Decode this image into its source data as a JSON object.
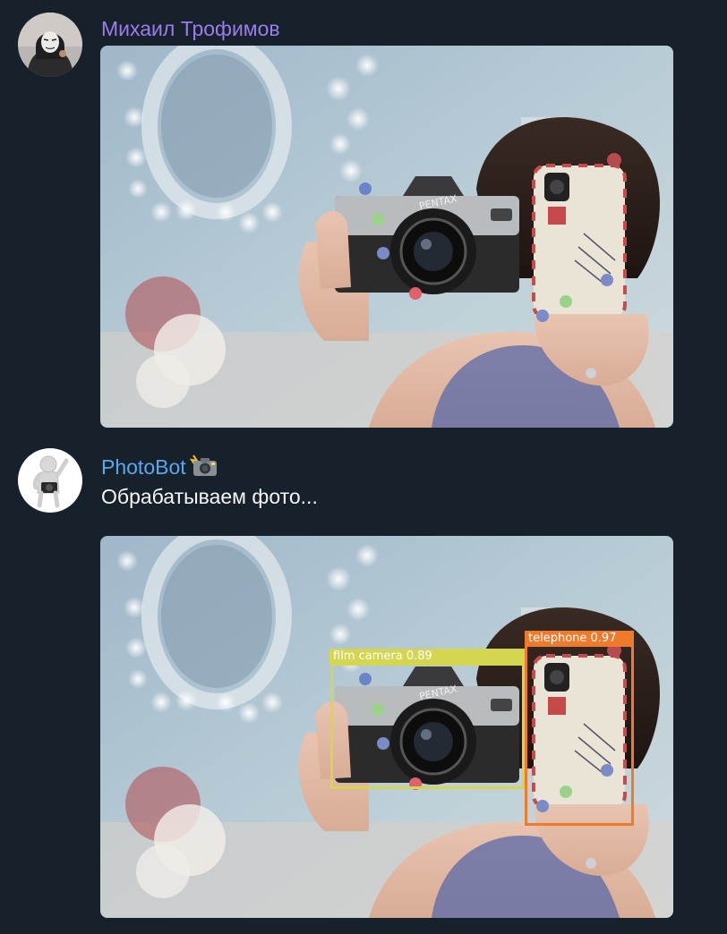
{
  "messages": [
    {
      "sender": "Михаил Трофимов",
      "sender_color": "#9c7cea",
      "avatar": "user-avatar-masked-person-icon",
      "attachment": "selfie-photo-with-film-camera-and-phone"
    },
    {
      "sender": "PhotoBot",
      "sender_emoji": "camera-with-flash-icon",
      "sender_color": "#59a7ec",
      "avatar": "bot-avatar-figure-with-camera-icon",
      "text": "Обрабатываем фото..."
    },
    {
      "attachment": "processed-photo-with-detections",
      "detections": [
        {
          "label": "film camera",
          "score": "0.89",
          "display": "film camera 0.89",
          "color": "#d3d64e"
        },
        {
          "label": "telephone",
          "score": "0.97",
          "display": "telephone 0.97",
          "color": "#f07a2c"
        }
      ]
    }
  ],
  "theme": {
    "background": "#17212b",
    "text": "#f5f5f5"
  }
}
